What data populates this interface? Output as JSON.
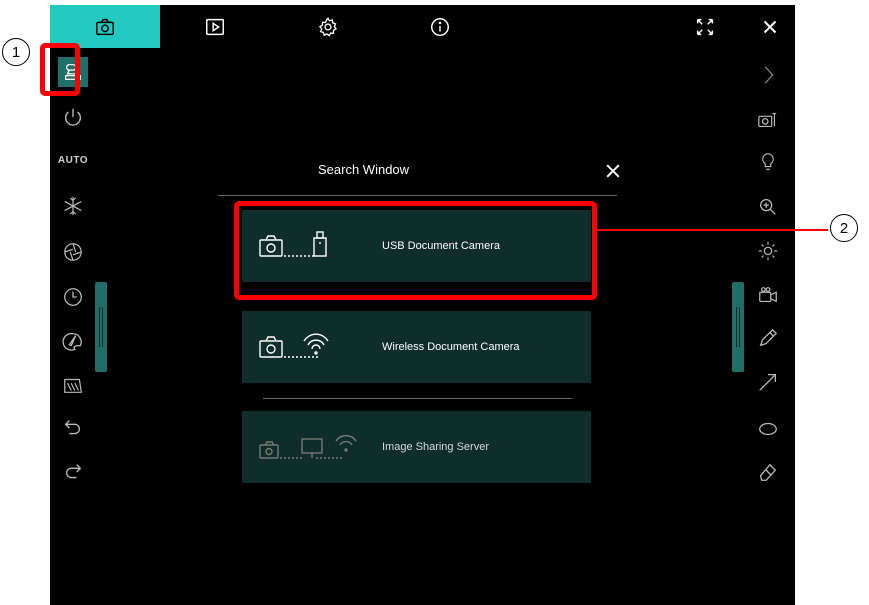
{
  "top_bar": {
    "tabs": [
      {
        "name": "camera-tab-icon",
        "active": true
      },
      {
        "name": "playback-tab-icon"
      },
      {
        "name": "settings-tab-icon"
      },
      {
        "name": "info-tab-icon"
      }
    ],
    "right_icons": [
      "fullscreen-icon",
      "close-icon"
    ]
  },
  "left_toolbar": {
    "items": [
      "source-camera-icon",
      "power-icon",
      "AUTO",
      "freeze-icon",
      "aperture-icon",
      "timer-icon",
      "paint-icon",
      "filter-icon",
      "undo-icon",
      "redo-icon"
    ],
    "auto_label": "AUTO"
  },
  "right_toolbar": {
    "items": [
      "chevron-right-icon",
      "camera-settings-icon",
      "lamp-icon",
      "zoom-in-icon",
      "brightness-icon",
      "record-icon",
      "pen-icon",
      "arrow-icon",
      "ellipse-icon",
      "eraser-icon"
    ]
  },
  "search_window": {
    "title": "Search Window",
    "options": [
      {
        "label": "USB Document Camera"
      },
      {
        "label": "Wireless Document Camera"
      },
      {
        "label": "Image Sharing Server",
        "disabled": true
      }
    ]
  },
  "annotations": {
    "callout_1": "1",
    "callout_2": "2",
    "highlight_color": "#ff0000"
  },
  "colors": {
    "accent": "#22c9c0",
    "option_bg": "#0f2d2b",
    "background": "#000000"
  }
}
